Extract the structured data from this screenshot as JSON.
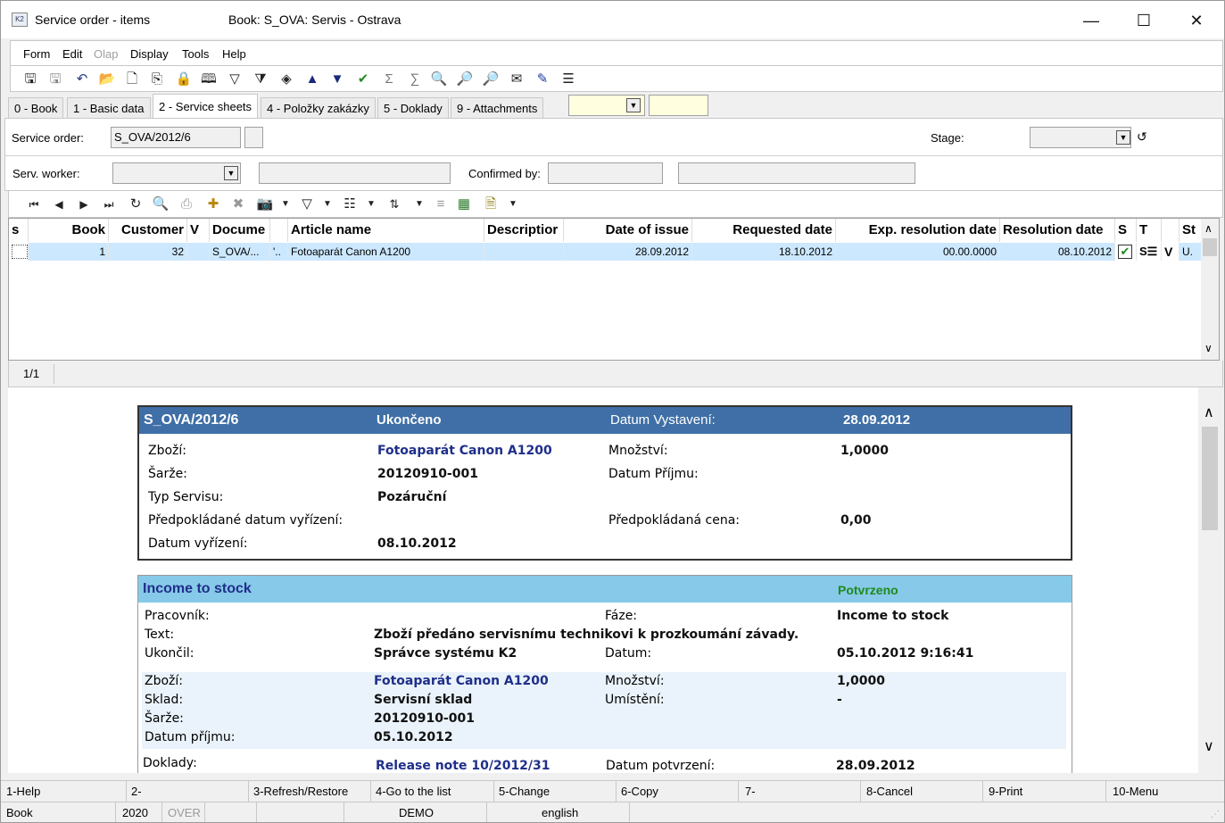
{
  "window": {
    "title": "Service order - items",
    "book": "Book: S_OVA: Servis - Ostrava",
    "minimize": "—",
    "maximize": "☐",
    "close": "✕"
  },
  "menu": [
    "Form",
    "Edit",
    "Olap",
    "Display",
    "Tools",
    "Help"
  ],
  "tabs": [
    "0 - Book",
    "1 - Basic data",
    "2 - Service sheets",
    "4 - Položky zakázky",
    "5 - Doklady",
    "9 - Attachments"
  ],
  "form": {
    "service_order_label": "Service order:",
    "service_order_value": "S_OVA/2012/6",
    "stage_label": "Stage:",
    "serv_worker_label": "Serv. worker:",
    "confirmed_by_label": "Confirmed by:"
  },
  "grid": {
    "columns": [
      "s",
      "Book",
      "Customer",
      "V",
      "Docume",
      "",
      "Article name",
      "Descriptior",
      "Date of issue",
      "Requested date",
      "Exp. resolution date",
      "Resolution date",
      "S",
      "T",
      "",
      "St"
    ],
    "rows": [
      {
        "book": "1",
        "customer": "32",
        "doc": "S_OVA/...",
        "extra": "'..",
        "article": "Fotoaparát Canon A1200",
        "desc": "",
        "issue": "28.09.2012",
        "requested": "18.10.2012",
        "exp": "00.00.0000",
        "resolution": "08.10.2012",
        "t": "S☰",
        "v": "V",
        "st": "U."
      }
    ],
    "counter": "1/1"
  },
  "detail": {
    "card1": {
      "number": "S_OVA/2012/6",
      "state": "Ukončeno",
      "issue_label": "Datum Vystavení:",
      "issue_value": "28.09.2012",
      "goods_label": "Zboží:",
      "goods_value": "Fotoaparát Canon A1200",
      "qty_label": "Množství:",
      "qty_value": "1,0000",
      "batch_label": "Šarže:",
      "batch_value": "20120910-001",
      "receipt_label": "Datum Příjmu:",
      "type_label": "Typ Servisu:",
      "type_value": "Pozáruční",
      "expected_date_label": "Předpokládané datum vyřízení:",
      "expected_price_label": "Předpokládaná cena:",
      "expected_price_value": "0,00",
      "done_label": "Datum vyřízení:",
      "done_value": "08.10.2012"
    },
    "card2": {
      "title": "Income to stock",
      "state": "Potvrzeno",
      "worker_label": "Pracovník:",
      "phase_label": "Fáze:",
      "phase_value": "Income to stock",
      "text_label": "Text:",
      "text_value": "Zboží předáno servisnímu technikovi k prozkoumání závady.",
      "ended_label": "Ukončil:",
      "ended_value": "Správce systému K2",
      "date_label": "Datum:",
      "date_value": "05.10.2012 9:16:41",
      "goods_label": "Zboží:",
      "goods_value": "Fotoaparát Canon A1200",
      "qty_label": "Množství:",
      "qty_value": "1,0000",
      "store_label": "Sklad:",
      "store_value": "Servisní sklad",
      "location_label": "Umístění:",
      "location_value": "-",
      "batch_label": "Šarže:",
      "batch_value": "20120910-001",
      "receipt_label": "Datum příjmu:",
      "receipt_value": "05.10.2012",
      "docs_label": "Doklady:",
      "docs_value": "Release note 10/2012/31",
      "confirm_label": "Datum potvrzení:",
      "confirm_value": "28.09.2012"
    }
  },
  "fkeys": [
    "1-Help",
    "2-",
    "3-Refresh/Restore",
    "4-Go to the list",
    "5-Change",
    "6-Copy",
    "7-",
    "8-Cancel",
    "9-Print",
    "10-Menu"
  ],
  "status": {
    "book": "Book",
    "year": "2020",
    "mode": "OVER",
    "db": "DEMO",
    "lang": "english"
  },
  "colors": {
    "card1_header": "#3f6fa6",
    "card2_header": "#87c9e8",
    "selected_row": "#cce8ff",
    "potvrzeno": "#1e8a1e"
  }
}
